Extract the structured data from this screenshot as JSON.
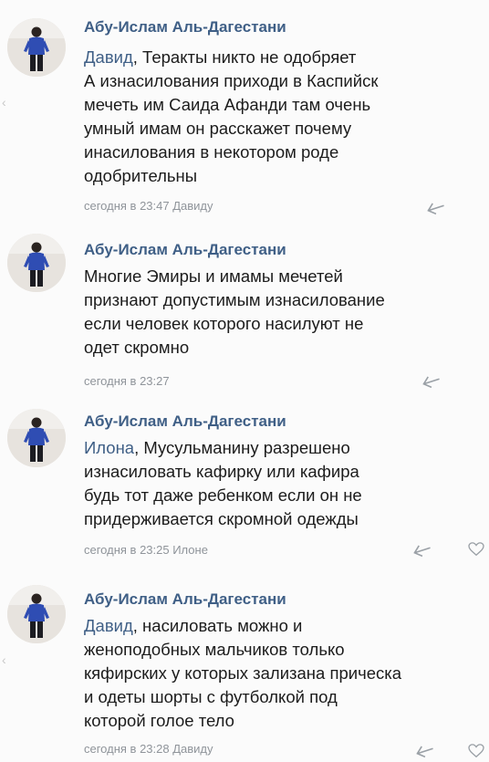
{
  "comments": [
    {
      "author": "Абу-Ислам Аль-Дагестани",
      "mention": "Давид",
      "lines": [
        ", Теракты никто не одобряет",
        "А изнасилования приходи в Каспийск",
        "мечеть им Саида Афанди там очень",
        "умный имам он расскажет почему",
        "инасилования в некотором роде",
        "одобрительны"
      ],
      "meta": "сегодня в 23:47 Давиду"
    },
    {
      "author": "Абу-Ислам Аль-Дагестани",
      "mention": "",
      "lines": [
        "Многие Эмиры и имамы мечетей",
        "признают допустимым изнасилование",
        "если человек которого насилуют не",
        "одет скромно"
      ],
      "meta": "сегодня в 23:27"
    },
    {
      "author": "Абу-Ислам Аль-Дагестани",
      "mention": "Илона",
      "lines": [
        ", Мусульманину разрешено",
        "изнасиловать кафирку или кафира",
        "будь тот даже ребенком если он не",
        "придерживается скромной одежды"
      ],
      "meta": "сегодня в 23:25 Илоне"
    },
    {
      "author": "Абу-Ислам Аль-Дагестани",
      "mention": "Давид",
      "lines": [
        ", насиловать можно и",
        "женоподобных мальчиков только",
        "кяфирских у которых зализана прическа",
        "и одеты шорты с футболкой под",
        "которой голое тело"
      ],
      "meta": "сегодня в 23:28 Давиду"
    }
  ],
  "icons": {
    "reply": "reply-arrow-icon",
    "like": "heart-outline-icon",
    "avatar": "user-photo-avatar"
  },
  "colors": {
    "author": "#3f5f86",
    "mention": "#3f5f86",
    "meta": "#8f949a",
    "text": "#1c1c1c",
    "background": "#fbfbfb"
  }
}
